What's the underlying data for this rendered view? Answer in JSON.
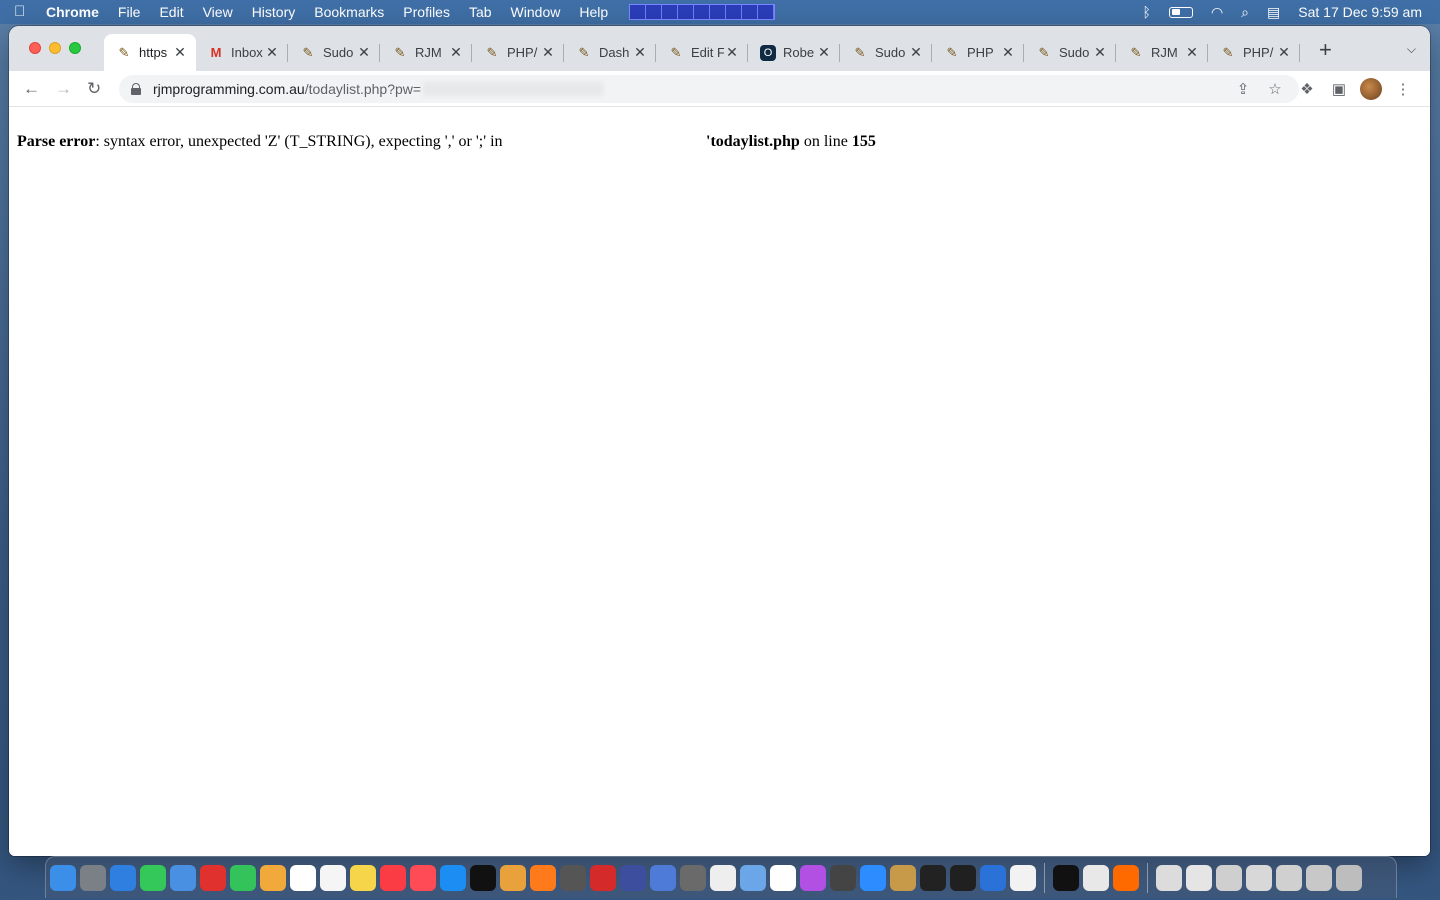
{
  "menubar": {
    "items": [
      "Chrome",
      "File",
      "Edit",
      "View",
      "History",
      "Bookmarks",
      "Profiles",
      "Tab",
      "Window",
      "Help"
    ],
    "clock": "Sat 17 Dec  9:59 am"
  },
  "tabs": [
    {
      "title": "https",
      "active": true,
      "favicon": "pencil-icon"
    },
    {
      "title": "Inbox",
      "active": false,
      "favicon": "gmail-icon"
    },
    {
      "title": "Sudo",
      "active": false,
      "favicon": "pencil-icon"
    },
    {
      "title": "RJM",
      "active": false,
      "favicon": "pencil-icon"
    },
    {
      "title": "PHP/",
      "active": false,
      "favicon": "pencil-icon"
    },
    {
      "title": "Dash",
      "active": false,
      "favicon": "pencil-icon"
    },
    {
      "title": "Edit F",
      "active": false,
      "favicon": "pencil-icon"
    },
    {
      "title": "Robe",
      "active": false,
      "favicon": "dark-icon"
    },
    {
      "title": "Sudo",
      "active": false,
      "favicon": "pencil-icon"
    },
    {
      "title": "PHP",
      "active": false,
      "favicon": "pencil-icon"
    },
    {
      "title": "Sudo",
      "active": false,
      "favicon": "pencil-icon"
    },
    {
      "title": "RJM",
      "active": false,
      "favicon": "pencil-icon"
    },
    {
      "title": "PHP/",
      "active": false,
      "favicon": "pencil-icon"
    }
  ],
  "toolbar": {
    "url_host": "rjmprogramming.com.au",
    "url_path": "/todaylist.php?pw="
  },
  "page": {
    "error_label": "Parse error",
    "error_text": ": syntax error, unexpected 'Z' (T_STRING), expecting ',' or ';' in",
    "file_name": "'todaylist.php",
    "line_text": " on line ",
    "line_number": "155"
  },
  "colors": {
    "menubar": "#3f6fa6",
    "tabstrip": "#dee1e6",
    "close": "#fe5f57",
    "minimize": "#febc2e",
    "zoom": "#28c840"
  }
}
